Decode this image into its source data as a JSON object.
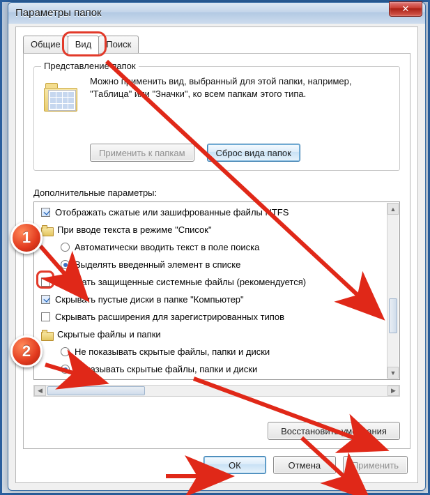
{
  "window": {
    "title": "Параметры папок",
    "close": "✕"
  },
  "tabs": {
    "general": "Общие",
    "view": "Вид",
    "search": "Поиск"
  },
  "group": {
    "legend": "Представление папок",
    "desc": "Можно применить вид, выбранный для этой папки, например, \"Таблица\" или \"Значки\", ко всем папкам этого типа.",
    "apply_btn": "Применить к папкам",
    "reset_btn": "Сброс вида папок"
  },
  "advanced_label": "Дополнительные параметры:",
  "list": {
    "item0": "Отображать сжатые или зашифрованные файлы NTFS",
    "item1": "При вводе текста в режиме \"Список\"",
    "item1a": "Автоматически вводить текст в поле поиска",
    "item1b": "Выделять введенный элемент в списке",
    "item2": "Скрывать защищенные системные файлы (рекомендуется)",
    "item3": "Скрывать пустые диски в папке \"Компьютер\"",
    "item4": "Скрывать расширения для зарегистрированных типов",
    "item5": "Скрытые файлы и папки",
    "item5a": "Не показывать скрытые файлы, папки и диски",
    "item5b": "Показывать скрытые файлы, папки и диски"
  },
  "restore_btn": "Восстановить умолчания",
  "buttons": {
    "ok": "ОК",
    "cancel": "Отмена",
    "apply": "Применить"
  },
  "badges": {
    "one": "1",
    "two": "2"
  }
}
